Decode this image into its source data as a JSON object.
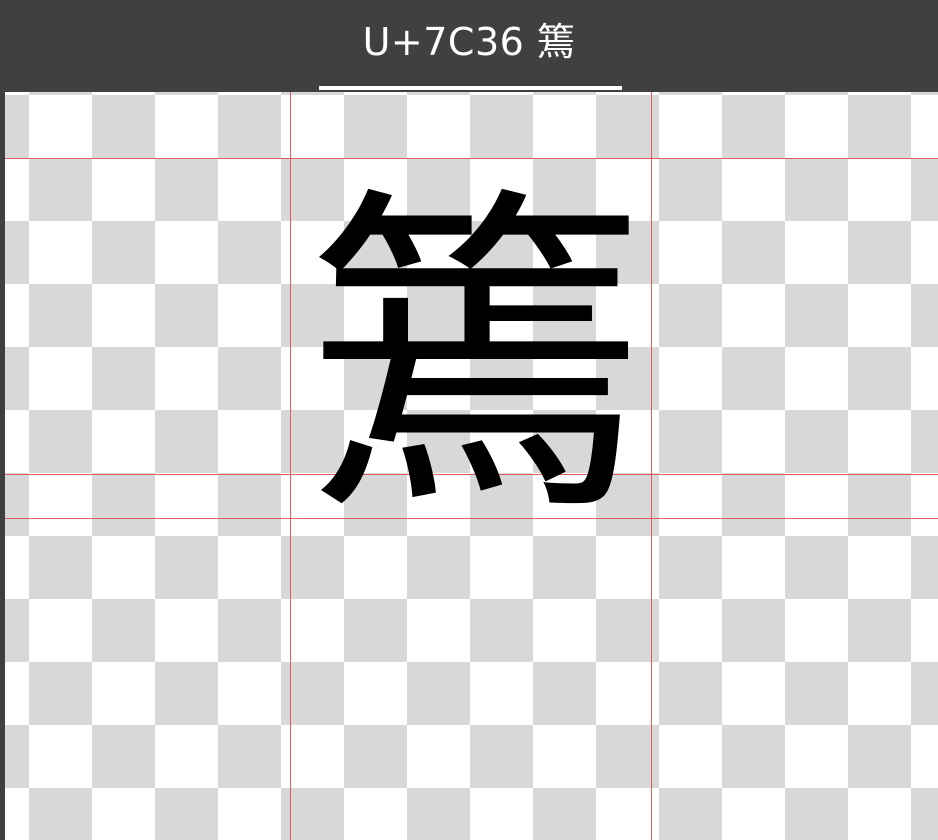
{
  "window": {
    "title": "U+7C36 篶"
  },
  "canvas": {
    "glyph": "篶"
  }
}
